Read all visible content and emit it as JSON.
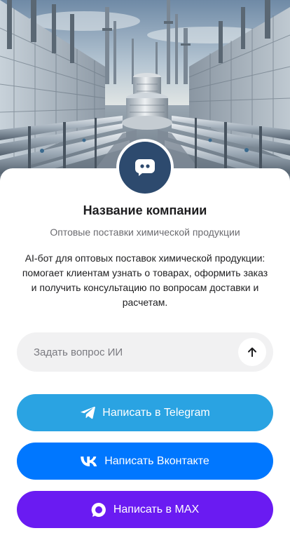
{
  "company": {
    "name": "Название компании",
    "subtitle": "Оптовые поставки химической продукции",
    "description": "AI-бот для оптовых поставок химической продукции: помогает клиентам узнать о товарах, оформить заказ и получить консультацию по вопросам доставки и расчетам."
  },
  "ask": {
    "placeholder": "Задать вопрос ИИ",
    "send_icon": "arrow-up-icon"
  },
  "buttons": {
    "telegram": {
      "label": "Написать в Telegram",
      "icon": "telegram-icon",
      "color": "#2aa3e2"
    },
    "vk": {
      "label": "Написать Вконтакте",
      "icon": "vk-icon",
      "color": "#0077ff"
    },
    "max": {
      "label": "Написать в MAX",
      "icon": "max-icon",
      "color": "#6a1bf2"
    }
  },
  "colors": {
    "avatar": "#2d4a6e",
    "input_bg": "#f1f1f2"
  },
  "avatar_icon": "chat-bot-icon"
}
